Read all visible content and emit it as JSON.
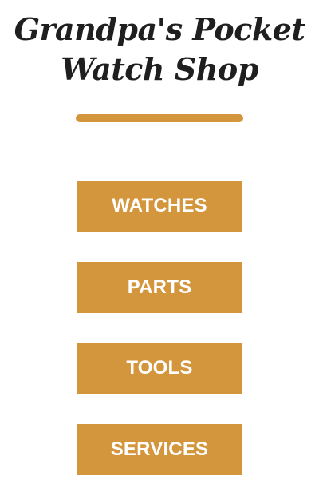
{
  "header": {
    "title_line1": "Grandpa's Pocket",
    "title_line2": "Watch Shop"
  },
  "colors": {
    "accent": "#d4963c",
    "title": "#1f1f1f",
    "button_text": "#ffffff"
  },
  "nav": {
    "items": [
      {
        "label": "WATCHES"
      },
      {
        "label": "PARTS"
      },
      {
        "label": "TOOLS"
      },
      {
        "label": "SERVICES"
      }
    ]
  }
}
